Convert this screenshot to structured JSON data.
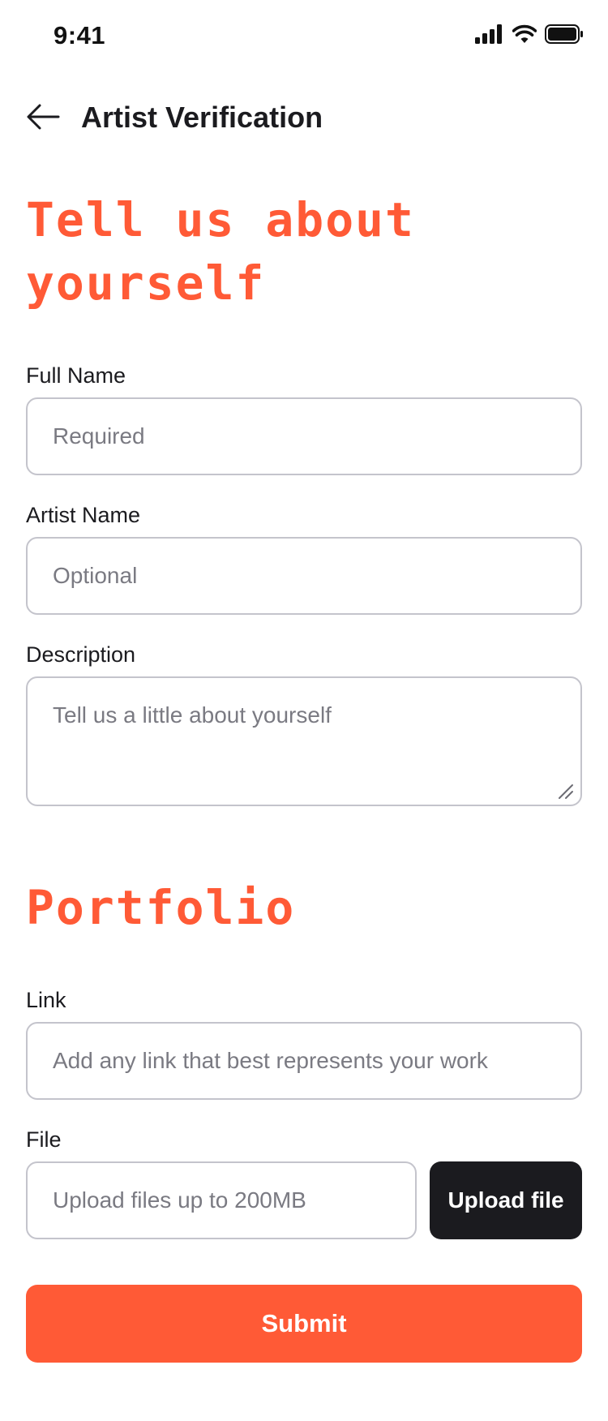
{
  "status_bar": {
    "time": "9:41"
  },
  "header": {
    "title": "Artist Verification"
  },
  "about": {
    "heading": "Tell us about yourself",
    "full_name": {
      "label": "Full Name",
      "placeholder": "Required"
    },
    "artist_name": {
      "label": "Artist Name",
      "placeholder": "Optional"
    },
    "description": {
      "label": "Description",
      "placeholder": "Tell us a little about yourself"
    }
  },
  "portfolio": {
    "heading": "Portfolio",
    "link": {
      "label": "Link",
      "placeholder": "Add any link that best represents your work"
    },
    "file": {
      "label": "File",
      "placeholder": "Upload files up to 200MB",
      "upload_label": "Upload file"
    }
  },
  "submit_label": "Submit",
  "colors": {
    "accent": "#ff5a36",
    "dark_button": "#1b1b1f",
    "border": "#c4c4cc",
    "placeholder": "#7a7a82"
  },
  "icons": {
    "back": "arrow-left-icon",
    "signal": "signal-icon",
    "wifi": "wifi-icon",
    "battery": "battery-icon"
  }
}
